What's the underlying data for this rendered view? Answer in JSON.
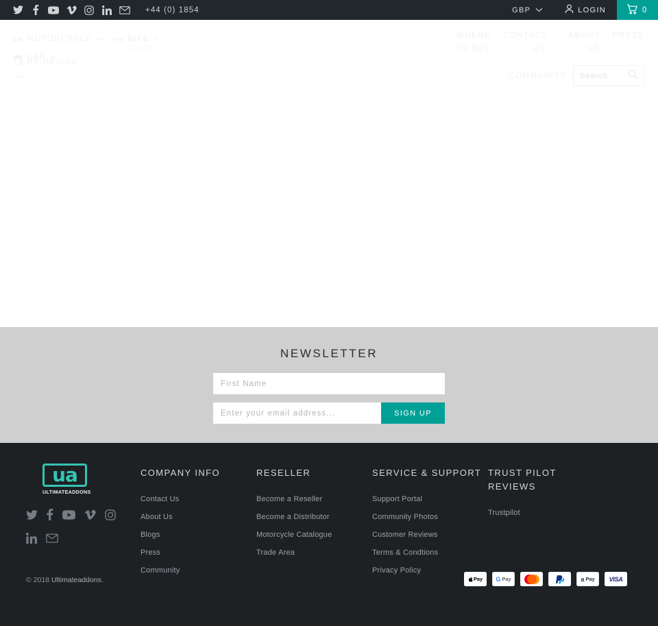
{
  "topbar": {
    "social": [
      {
        "name": "twitter-icon",
        "label": "Twitter"
      },
      {
        "name": "facebook-icon",
        "label": "Facebook"
      },
      {
        "name": "youtube-icon",
        "label": "YouTube"
      },
      {
        "name": "vimeo-icon",
        "label": "Vimeo"
      },
      {
        "name": "instagram-icon",
        "label": "Instagram"
      },
      {
        "name": "linkedin-icon",
        "label": "LinkedIn"
      },
      {
        "name": "email-icon",
        "label": "Email"
      }
    ],
    "phone": "+44 (0) 1854",
    "currency": "GBP",
    "login": "LOGIN",
    "cart_count": "0",
    "cart_color": "#00a097"
  },
  "nav": {
    "primary": [
      {
        "label": "MOTORCYCLE",
        "icon": "motorcycle-icon",
        "has_chevron": true
      },
      {
        "label": "BIKE",
        "icon": "bicycle-icon",
        "has_chevron": true
      },
      {
        "label": "CAR",
        "icon": "car-icon",
        "has_chevron": true
      }
    ],
    "by_device": "BY DEVICE",
    "ghost_text": "SHOP",
    "secondary": [
      {
        "label": "WHERE TO BUY"
      },
      {
        "label": "CONTACT US"
      },
      {
        "label": "ABOUT US"
      },
      {
        "label": "PRESS"
      }
    ],
    "community": "COMMUNITY",
    "search_placeholder": "Search",
    "search_value": ""
  },
  "newsletter": {
    "heading": "NEWSLETTER",
    "first_name_placeholder": "First Name",
    "first_name_value": "",
    "email_placeholder": "Enter your email address...",
    "email_value": "",
    "signup_label": "SIGN UP",
    "accent": "#00a097",
    "background": "#cfcfcf"
  },
  "footer": {
    "background": "#1d2124",
    "logo": {
      "mark": "ua",
      "wordmark": "ULTIMATEADDONS",
      "color": "#35c4b5"
    },
    "social": [
      {
        "name": "twitter-icon",
        "label": "Twitter"
      },
      {
        "name": "facebook-icon",
        "label": "Facebook"
      },
      {
        "name": "youtube-icon",
        "label": "YouTube"
      },
      {
        "name": "vimeo-icon",
        "label": "Vimeo"
      },
      {
        "name": "instagram-icon",
        "label": "Instagram"
      },
      {
        "name": "linkedin-icon",
        "label": "LinkedIn"
      },
      {
        "name": "email-icon",
        "label": "Email"
      }
    ],
    "columns": [
      {
        "title": "COMPANY INFO",
        "links": [
          "Contact Us",
          "About Us",
          "Blogs",
          "Press",
          "Community"
        ]
      },
      {
        "title": "RESELLER",
        "links": [
          "Become a Reseller",
          "Become a Distributor",
          "Motorcycle Catalogue",
          "Trade Area"
        ]
      },
      {
        "title": "SERVICE & SUPPORT",
        "links": [
          "Support Portal",
          "Community Photos",
          "Customer Reviews",
          "Terms & Condtions",
          "Privacy Policy"
        ]
      },
      {
        "title": "TRUST PILOT REVIEWS",
        "links": [
          "Trustpilot"
        ]
      }
    ],
    "copyright_prefix": "© 2018",
    "copyright_brand": "Ultimateaddons.",
    "payments": [
      {
        "name": "apple-pay-icon",
        "label": "Pay"
      },
      {
        "name": "google-pay-icon",
        "label": "Pay"
      },
      {
        "name": "mastercard-icon",
        "label": ""
      },
      {
        "name": "paypal-icon",
        "label": "P"
      },
      {
        "name": "amazon-pay-icon",
        "label": "Pay"
      },
      {
        "name": "visa-icon",
        "label": "VISA"
      }
    ]
  }
}
